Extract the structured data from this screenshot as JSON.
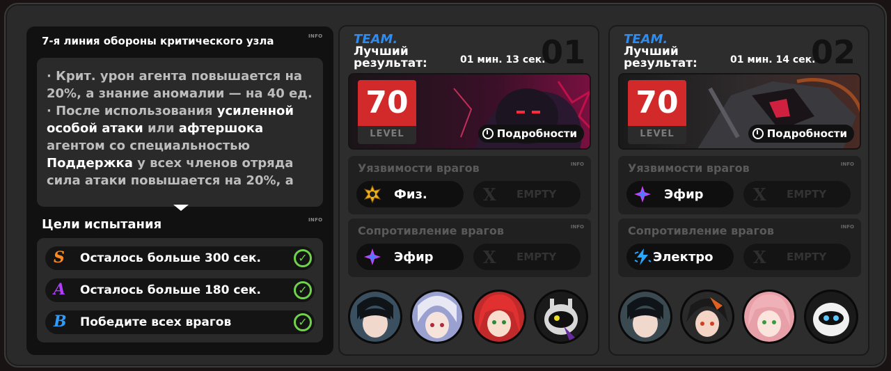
{
  "left": {
    "title": "7-я линия обороны критического узла",
    "info": "INFO",
    "desc": {
      "p1": "· Крит. урон агента повышается на 20%, а знание аномалии — на 40 ед.",
      "p2_a": "· После использования ",
      "p2_b": "усиленной особой атаки",
      "p2_c": " или ",
      "p2_d": "афтершока",
      "p2_e": " агентом со специальностью ",
      "p2_f": "Поддержка",
      "p2_g": " у всех членов отряда сила атаки повышается на 20%, а"
    },
    "goals_title": "Цели испытания",
    "goals_info": "INFO",
    "goals": [
      {
        "grade": "S",
        "text": "Осталось больше 300 сек.",
        "color": "#ff8a1e"
      },
      {
        "grade": "A",
        "text": "Осталось больше 180 сек.",
        "color": "#b23cff"
      },
      {
        "grade": "B",
        "text": "Победите всех врагов",
        "color": "#2d9cff"
      }
    ]
  },
  "teams": [
    {
      "label": "TEAM.",
      "best_label": "Лучший результат:",
      "time": "01 мин.  13 сек.",
      "number": "01",
      "level": "70",
      "level_label": "LEVEL",
      "details": "Подробности",
      "weak_title": "Уязвимости врагов",
      "weak_info": "INFO",
      "weak": [
        {
          "icon": "physical-icon",
          "text": "Физ."
        },
        {
          "icon": "empty",
          "text": "EMPTY"
        }
      ],
      "resist_title": "Сопротивление врагов",
      "resist_info": "INFO",
      "resist": [
        {
          "icon": "ether-icon",
          "text": "Эфир"
        },
        {
          "icon": "empty",
          "text": "EMPTY"
        }
      ]
    },
    {
      "label": "TEAM.",
      "best_label": "Лучший результат:",
      "time": "01 мин.  14 сек.",
      "number": "02",
      "level": "70",
      "level_label": "LEVEL",
      "details": "Подробности",
      "weak_title": "Уязвимости врагов",
      "weak_info": "INFO",
      "weak": [
        {
          "icon": "ether-icon",
          "text": "Эфир"
        },
        {
          "icon": "empty",
          "text": "EMPTY"
        }
      ],
      "resist_title": "Сопротивление врагов",
      "resist_info": "INFO",
      "resist": [
        {
          "icon": "electric-icon",
          "text": "Электро"
        },
        {
          "icon": "empty",
          "text": "EMPTY"
        }
      ]
    }
  ],
  "colors": {
    "accent_blue": "#2e8cf0",
    "level_red": "#d22a2a",
    "check_green": "#6fd24a"
  }
}
